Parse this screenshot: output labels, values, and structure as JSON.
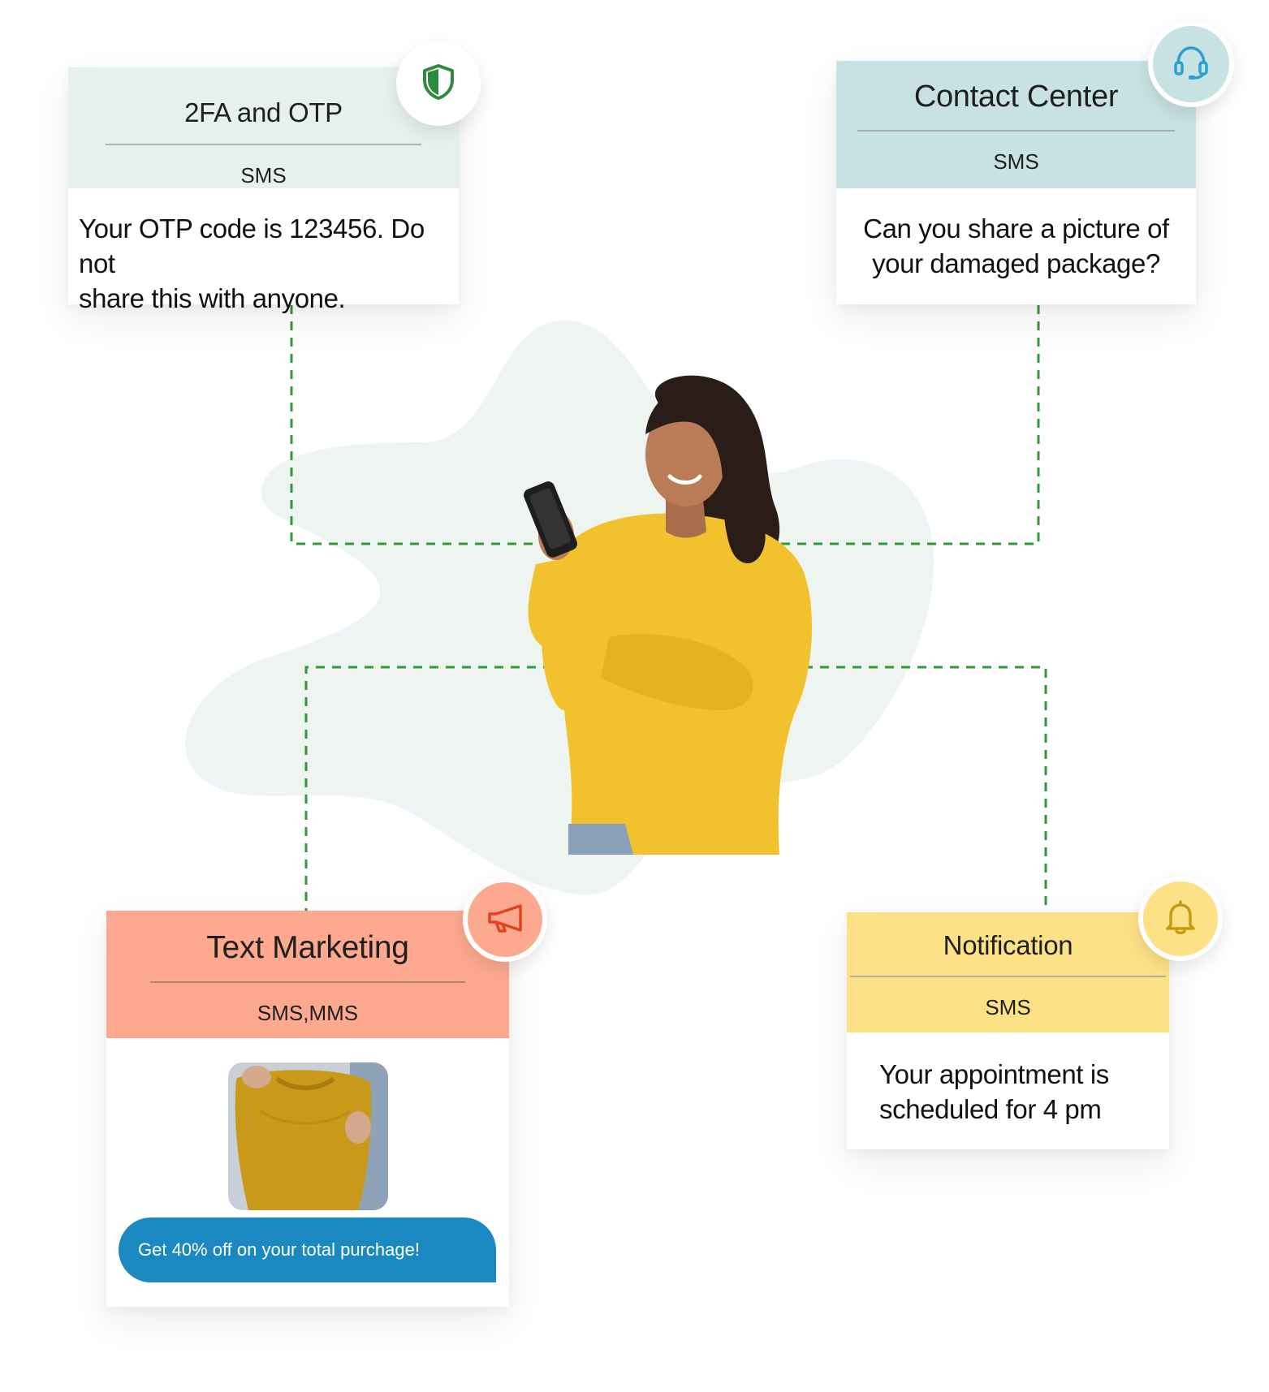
{
  "cards": {
    "otp": {
      "title": "2FA and OTP",
      "channel": "SMS",
      "message_line1": "Your OTP code is 123456. Do not",
      "message_line2": "share this with anyone.",
      "icon": "shield-icon",
      "color": "#e7f1ec",
      "icon_color": "#2e8b3c"
    },
    "contact": {
      "title": "Contact Center",
      "channel": "SMS",
      "message_line1": "Can you share a picture of",
      "message_line2": "your damaged package?",
      "icon": "headset-icon",
      "color": "#c8e1e3",
      "icon_color": "#2b9fd2"
    },
    "marketing": {
      "title": "Text Marketing",
      "channel": "SMS,MMS",
      "image": "yellow-sweater-photo",
      "promo": "Get 40% off on your total purchage!",
      "icon": "megaphone-icon",
      "color": "#fca98f",
      "icon_color": "#e2431c",
      "bubble_color": "#1a89c2"
    },
    "notification": {
      "title": "Notification",
      "channel": "SMS",
      "message_line1": "Your appointment is",
      "message_line2": "scheduled for 4 pm",
      "icon": "bell-icon",
      "color": "#fde187",
      "icon_color": "#c39c12"
    }
  },
  "connector_color": "#2f9a3a",
  "center_image": "woman-in-yellow-sweater-with-phone"
}
